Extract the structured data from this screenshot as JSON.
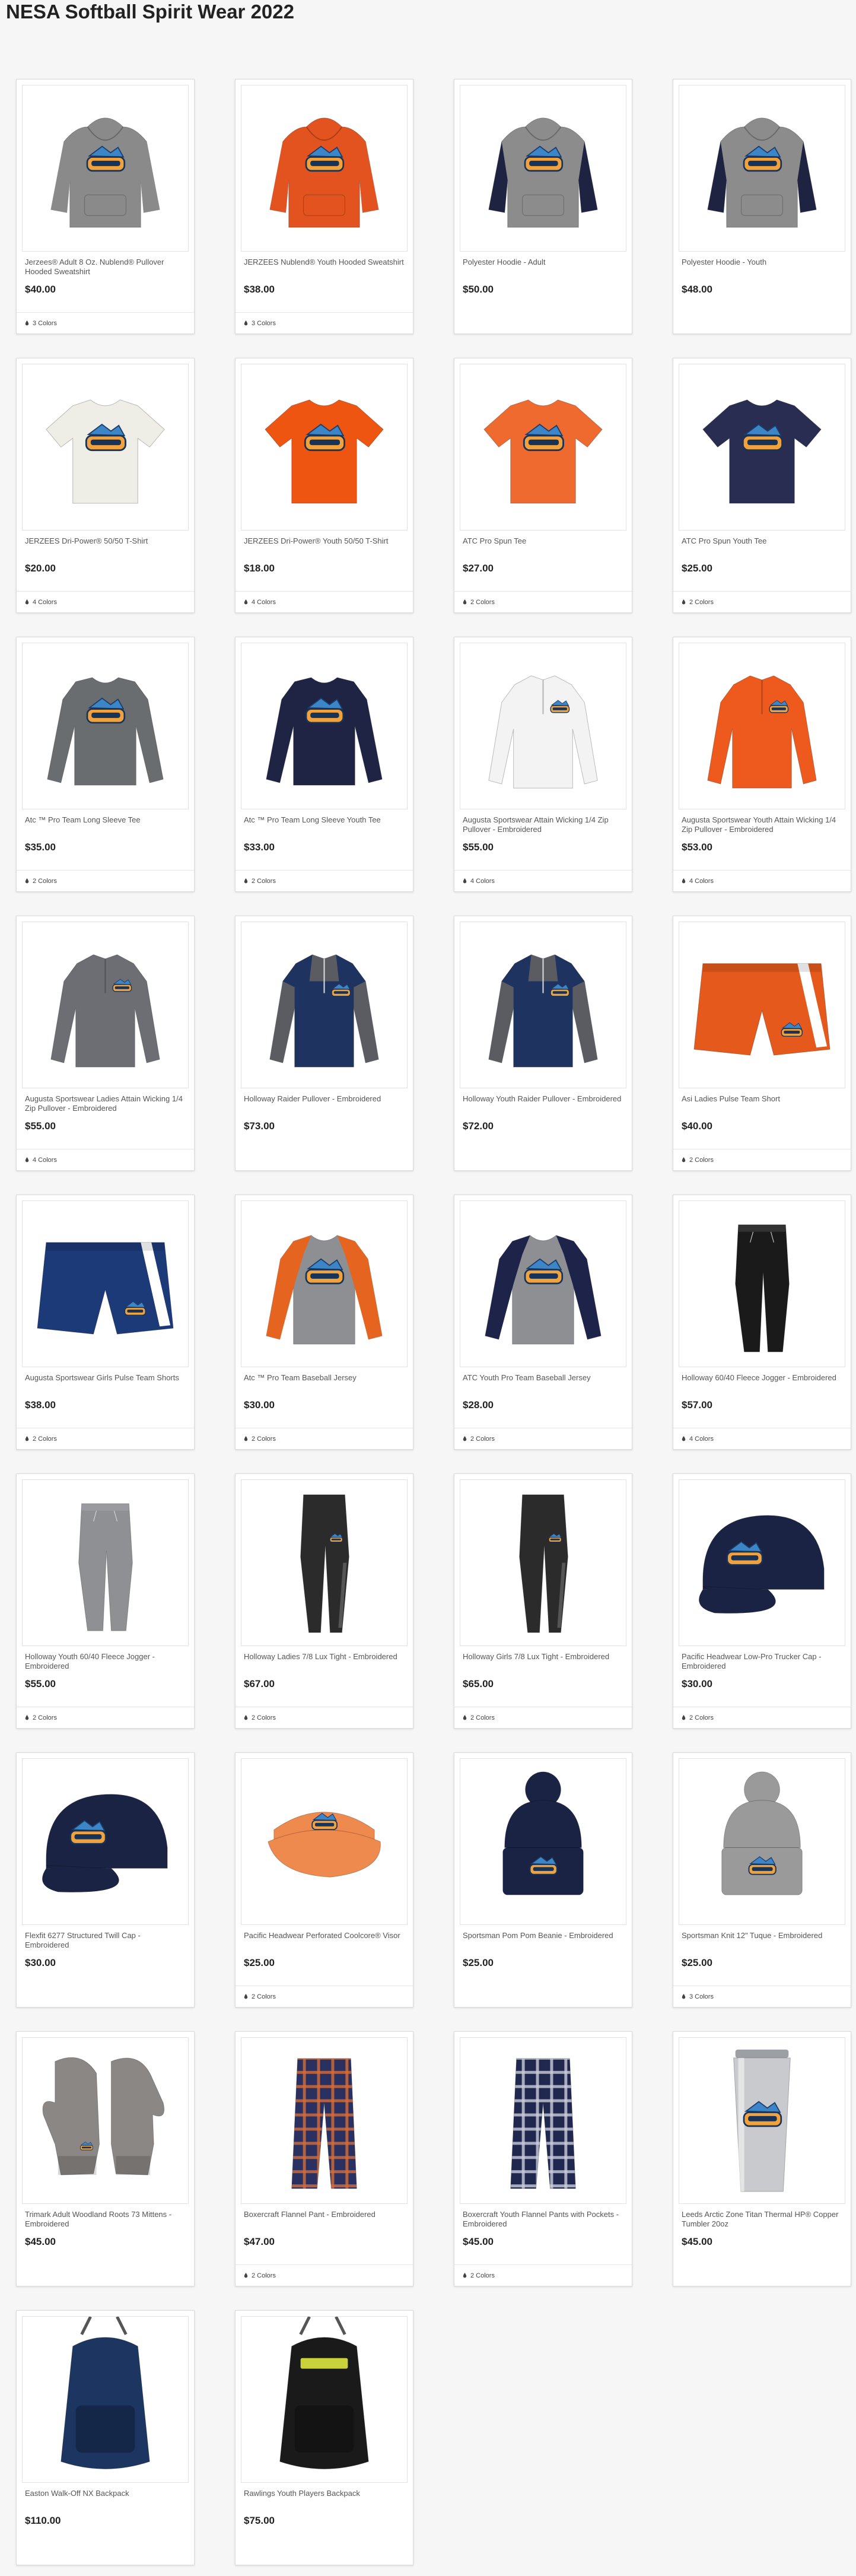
{
  "page": {
    "title": "NESA Softball Spirit Wear 2022"
  },
  "products": [
    {
      "name": "Jerzees® Adult 8 Oz. Nublend® Pullover Hooded Sweatshirt",
      "price": "$40.00",
      "colors": "3 Colors",
      "image": "hoodie-icon",
      "color": "#8a8a8a",
      "accent": "#8a8a8a"
    },
    {
      "name": "JERZEES Nublend® Youth Hooded Sweatshirt",
      "price": "$38.00",
      "colors": "3 Colors",
      "image": "hoodie-icon",
      "color": "#e2531f",
      "accent": "#e2531f"
    },
    {
      "name": "Polyester Hoodie - Adult",
      "price": "$50.00",
      "colors": "",
      "image": "hoodie-icon",
      "color": "#8c8c8c",
      "accent": "#1d2340"
    },
    {
      "name": "Polyester Hoodie - Youth",
      "price": "$48.00",
      "colors": "",
      "image": "hoodie-icon",
      "color": "#8c8c8c",
      "accent": "#1d2340"
    },
    {
      "name": "JERZEES Dri-Power® 50/50 T-Shirt",
      "price": "$20.00",
      "colors": "4 Colors",
      "image": "tshirt-icon",
      "color": "#efeee6",
      "accent": "#efeee6"
    },
    {
      "name": "JERZEES Dri-Power® Youth 50/50 T-Shirt",
      "price": "$18.00",
      "colors": "4 Colors",
      "image": "tshirt-icon",
      "color": "#ee5511",
      "accent": "#ee5511"
    },
    {
      "name": "ATC Pro Spun Tee",
      "price": "$27.00",
      "colors": "2 Colors",
      "image": "tshirt-icon",
      "color": "#ef6a2f",
      "accent": "#ef6a2f"
    },
    {
      "name": "ATC Pro Spun Youth Tee",
      "price": "$25.00",
      "colors": "2 Colors",
      "image": "tshirt-icon",
      "color": "#2a2d52",
      "accent": "#2a2d52"
    },
    {
      "name": "Atc ™ Pro Team Long Sleeve Tee",
      "price": "$35.00",
      "colors": "2 Colors",
      "image": "longsleeve-icon",
      "color": "#6a6d70",
      "accent": "#6a6d70"
    },
    {
      "name": "Atc ™ Pro Team Long Sleeve Youth Tee",
      "price": "$33.00",
      "colors": "2 Colors",
      "image": "longsleeve-icon",
      "color": "#1f2445",
      "accent": "#1f2445"
    },
    {
      "name": "Augusta Sportswear Attain Wicking 1/4 Zip Pullover - Embroidered",
      "price": "$55.00",
      "colors": "4 Colors",
      "image": "quarterzip-icon",
      "color": "#f3f3f3",
      "accent": "#f3f3f3"
    },
    {
      "name": "Augusta Sportswear Youth Attain Wicking 1/4 Zip Pullover - Embroidered",
      "price": "$53.00",
      "colors": "4 Colors",
      "image": "quarterzip-icon",
      "color": "#ee5a1d",
      "accent": "#ee5a1d"
    },
    {
      "name": "Augusta Sportswear Ladies Attain Wicking 1/4 Zip Pullover - Embroidered",
      "price": "$55.00",
      "colors": "4 Colors",
      "image": "quarterzip-icon",
      "color": "#6c6e73",
      "accent": "#6c6e73"
    },
    {
      "name": "Holloway Raider Pullover - Embroidered",
      "price": "$73.00",
      "colors": "",
      "image": "pullover-icon",
      "color": "#1f3360",
      "accent": "#5a5c62"
    },
    {
      "name": "Holloway Youth Raider Pullover - Embroidered",
      "price": "$72.00",
      "colors": "",
      "image": "pullover-icon",
      "color": "#1f3360",
      "accent": "#5a5c62"
    },
    {
      "name": "Asi Ladies Pulse Team Short",
      "price": "$40.00",
      "colors": "2 Colors",
      "image": "shorts-icon",
      "color": "#e55a1c",
      "accent": "#ffffff"
    },
    {
      "name": "Augusta Sportswear Girls Pulse Team Shorts",
      "price": "$38.00",
      "colors": "2 Colors",
      "image": "shorts-icon",
      "color": "#1d3a78",
      "accent": "#ffffff"
    },
    {
      "name": "Atc ™ Pro Team Baseball Jersey",
      "price": "$30.00",
      "colors": "2 Colors",
      "image": "raglan-icon",
      "color": "#8d8f92",
      "accent": "#e5641f"
    },
    {
      "name": "ATC Youth Pro Team Baseball Jersey",
      "price": "$28.00",
      "colors": "2 Colors",
      "image": "raglan-icon",
      "color": "#8d8f92",
      "accent": "#1e2449"
    },
    {
      "name": "Holloway 60/40 Fleece Jogger - Embroidered",
      "price": "$57.00",
      "colors": "4 Colors",
      "image": "jogger-icon",
      "color": "#1a1a1a",
      "accent": "#1a1a1a"
    },
    {
      "name": "Holloway Youth 60/40 Fleece Jogger - Embroidered",
      "price": "$55.00",
      "colors": "2 Colors",
      "image": "jogger-icon",
      "color": "#8f9093",
      "accent": "#8f9093"
    },
    {
      "name": "Holloway Ladies 7/8 Lux Tight - Embroidered",
      "price": "$67.00",
      "colors": "2 Colors",
      "image": "tights-icon",
      "color": "#2b2b2b",
      "accent": "#555555"
    },
    {
      "name": "Holloway Girls 7/8 Lux Tight - Embroidered",
      "price": "$65.00",
      "colors": "2 Colors",
      "image": "tights-icon",
      "color": "#2b2b2b",
      "accent": "#555555"
    },
    {
      "name": "Pacific Headwear Low-Pro Trucker Cap - Embroidered",
      "price": "$30.00",
      "colors": "2 Colors",
      "image": "cap-icon",
      "color": "#1a2344",
      "accent": "#1a2344"
    },
    {
      "name": "Flexfit 6277 Structured Twill Cap - Embroidered",
      "price": "$30.00",
      "colors": "",
      "image": "cap-icon",
      "color": "#1a2344",
      "accent": "#1a2344"
    },
    {
      "name": "Pacific Headwear Perforated Coolcore® Visor",
      "price": "$25.00",
      "colors": "2 Colors",
      "image": "visor-icon",
      "color": "#ef8a4f",
      "accent": "#ef8a4f"
    },
    {
      "name": "Sportsman Pom Pom Beanie - Embroidered",
      "price": "$25.00",
      "colors": "",
      "image": "beanie-icon",
      "color": "#1a2344",
      "accent": "#1a2344"
    },
    {
      "name": "Sportsman Knit 12\" Tuque - Embroidered",
      "price": "$25.00",
      "colors": "3 Colors",
      "image": "beanie-icon",
      "color": "#9a9a9a",
      "accent": "#9a9a9a"
    },
    {
      "name": "Trimark Adult Woodland Roots 73 Mittens - Embroidered",
      "price": "$45.00",
      "colors": "",
      "image": "mittens-icon",
      "color": "#8a8784",
      "accent": "#8a8784"
    },
    {
      "name": "Boxercraft Flannel Pant - Embroidered",
      "price": "$47.00",
      "colors": "2 Colors",
      "image": "flannel-pant-icon",
      "color": "#2a3160",
      "accent": "#d66b3a"
    },
    {
      "name": "Boxercraft Youth Flannel Pants with Pockets - Embroidered",
      "price": "$45.00",
      "colors": "2 Colors",
      "image": "flannel-pant-icon",
      "color": "#20284f",
      "accent": "#c9ccd8"
    },
    {
      "name": "Leeds Arctic Zone Titan Thermal HP® Copper Tumbler 20oz",
      "price": "$45.00",
      "colors": "",
      "image": "tumbler-icon",
      "color": "#c8cacd",
      "accent": "#c8cacd"
    },
    {
      "name": "Easton Walk-Off NX Backpack",
      "price": "$110.00",
      "colors": "",
      "image": "backpack-icon",
      "color": "#1d3561",
      "accent": "#1d3561"
    },
    {
      "name": "Rawlings Youth Players Backpack",
      "price": "$75.00",
      "colors": "",
      "image": "backpack-icon",
      "color": "#1a1a1a",
      "accent": "#c9d23a"
    }
  ]
}
